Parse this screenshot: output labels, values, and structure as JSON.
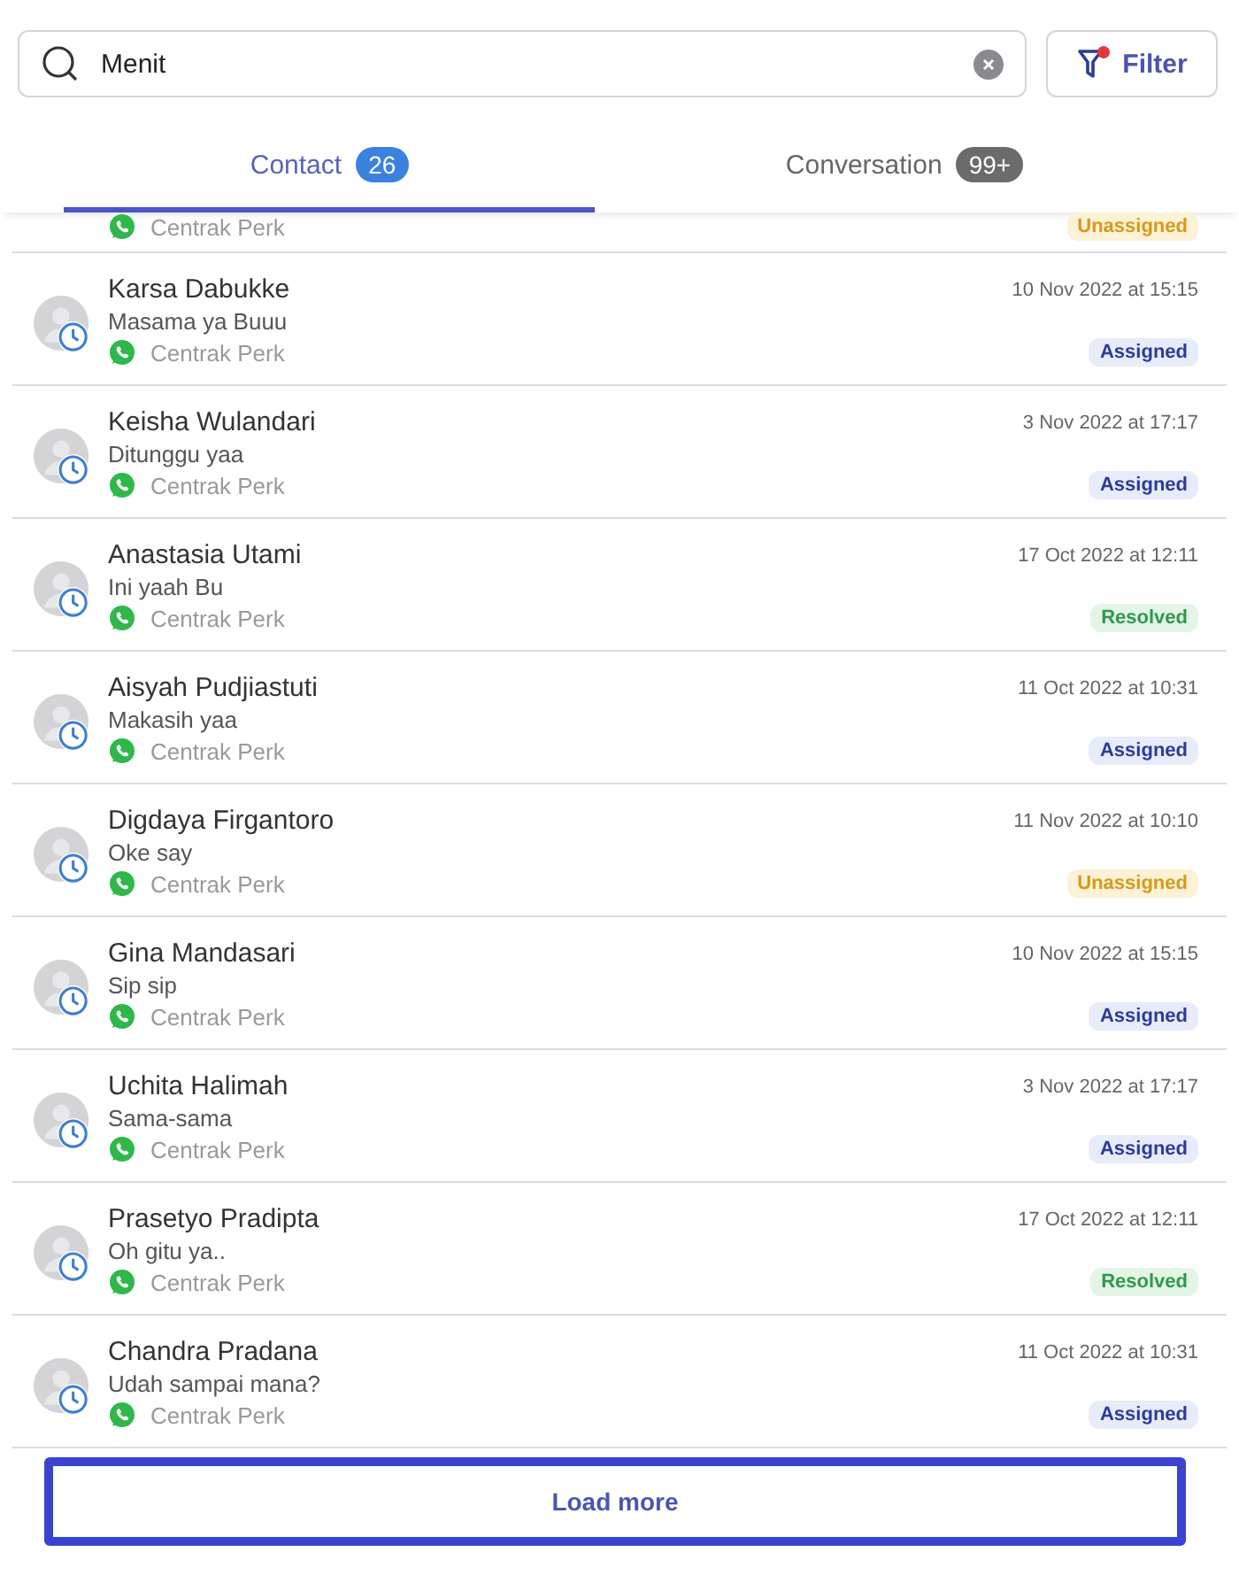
{
  "search": {
    "value": "Menit"
  },
  "filter": {
    "label": "Filter",
    "active": true
  },
  "tabs": [
    {
      "label": "Contact",
      "count": "26",
      "selected": true
    },
    {
      "label": "Conversation",
      "count": "99+",
      "selected": false
    }
  ],
  "clipped_row": {
    "channel": "Centrak Perk",
    "status": {
      "label": "Unassigned",
      "kind": "unassigned"
    }
  },
  "contacts": [
    {
      "name": "Karsa Dabukke",
      "message": "Masama ya Buuu",
      "channel": "Centrak Perk",
      "time": "10 Nov 2022 at 15:15",
      "status": {
        "label": "Assigned",
        "kind": "assigned"
      }
    },
    {
      "name": "Keisha Wulandari",
      "message": "Ditunggu yaa",
      "channel": "Centrak Perk",
      "time": "3 Nov 2022 at 17:17",
      "status": {
        "label": "Assigned",
        "kind": "assigned"
      }
    },
    {
      "name": "Anastasia Utami",
      "message": "Ini yaah Bu",
      "channel": "Centrak Perk",
      "time": "17 Oct 2022 at 12:11",
      "status": {
        "label": "Resolved",
        "kind": "resolved"
      }
    },
    {
      "name": "Aisyah Pudjiastuti",
      "message": "Makasih yaa",
      "channel": "Centrak Perk",
      "time": "11 Oct 2022 at 10:31",
      "status": {
        "label": "Assigned",
        "kind": "assigned"
      }
    },
    {
      "name": "Digdaya Firgantoro",
      "message": "Oke say",
      "channel": "Centrak Perk",
      "time": "11 Nov 2022 at 10:10",
      "status": {
        "label": "Unassigned",
        "kind": "unassigned"
      }
    },
    {
      "name": "Gina Mandasari",
      "message": "Sip sip",
      "channel": "Centrak Perk",
      "time": "10 Nov 2022 at 15:15",
      "status": {
        "label": "Assigned",
        "kind": "assigned"
      }
    },
    {
      "name": "Uchita Halimah",
      "message": "Sama-sama",
      "channel": "Centrak Perk",
      "time": "3 Nov 2022 at 17:17",
      "status": {
        "label": "Assigned",
        "kind": "assigned"
      }
    },
    {
      "name": "Prasetyo Pradipta",
      "message": "Oh gitu ya..",
      "channel": "Centrak Perk",
      "time": "17 Oct 2022 at 12:11",
      "status": {
        "label": "Resolved",
        "kind": "resolved"
      }
    },
    {
      "name": "Chandra Pradana",
      "message": "Udah sampai mana?",
      "channel": "Centrak Perk",
      "time": "11 Oct 2022 at 10:31",
      "status": {
        "label": "Assigned",
        "kind": "assigned"
      }
    }
  ],
  "load_more": {
    "label": "Load more"
  }
}
